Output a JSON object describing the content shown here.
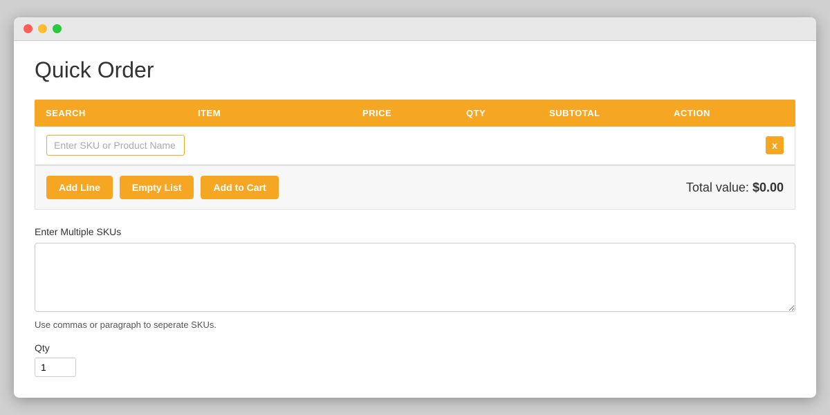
{
  "window": {
    "title": ""
  },
  "page": {
    "title": "Quick Order"
  },
  "table": {
    "columns": [
      {
        "key": "search",
        "label": "SEARCH"
      },
      {
        "key": "item",
        "label": "ITEM"
      },
      {
        "key": "price",
        "label": "PRICE"
      },
      {
        "key": "qty",
        "label": "QTY"
      },
      {
        "key": "subtotal",
        "label": "SUBTOTAL"
      },
      {
        "key": "action",
        "label": "ACTION"
      }
    ],
    "search_placeholder": "Enter SKU or Product Name",
    "delete_button_label": "x"
  },
  "footer": {
    "add_line_label": "Add Line",
    "empty_list_label": "Empty List",
    "add_to_cart_label": "Add to Cart",
    "total_label": "Total value:",
    "total_value": "$0.00"
  },
  "multi_sku": {
    "label": "Enter Multiple SKUs",
    "placeholder": "",
    "hint": "Use commas or paragraph to seperate SKUs."
  },
  "qty": {
    "label": "Qty",
    "value": "1"
  },
  "colors": {
    "accent": "#f5a623"
  }
}
